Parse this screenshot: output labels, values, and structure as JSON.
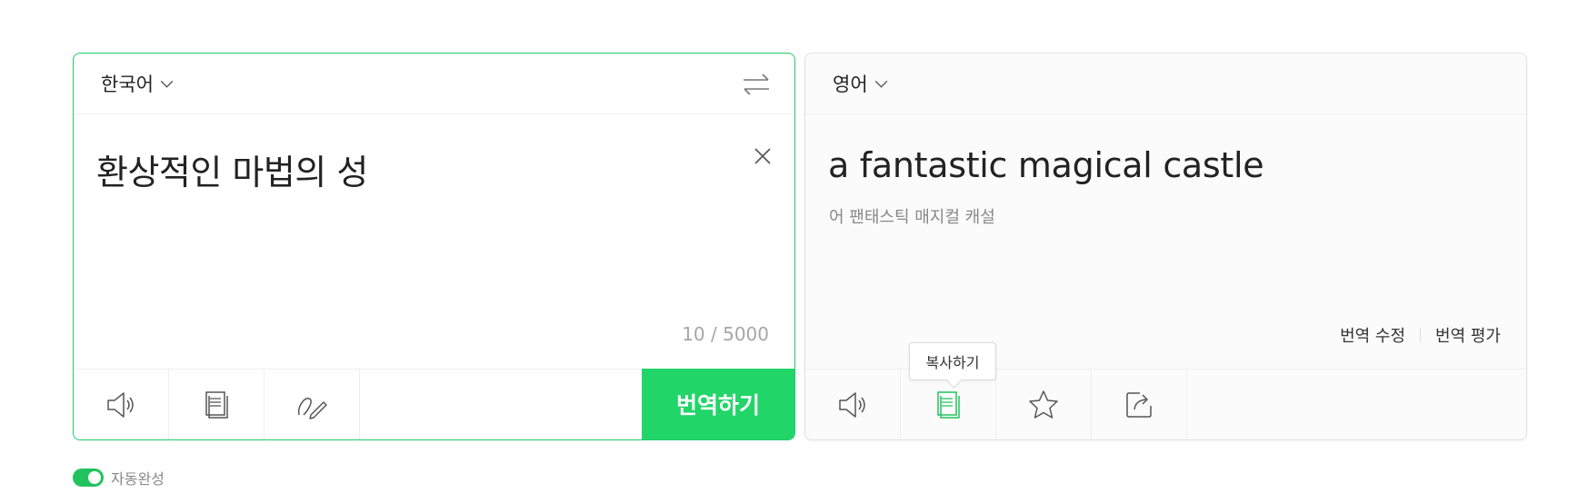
{
  "source": {
    "language": "한국어",
    "text": "환상적인 마법의 성",
    "char_count": "10 / 5000",
    "translate_button": "번역하기",
    "border_color": "#1ec96a"
  },
  "target": {
    "language": "영어",
    "text": "a fantastic magical castle",
    "pronunciation": "어 팬태스틱 매지컬 캐설",
    "edit_link": "번역 수정",
    "rate_link": "번역 평가",
    "copy_tooltip": "복사하기"
  },
  "autocomplete": {
    "label": "자동완성",
    "enabled": true
  },
  "colors": {
    "accent": "#22d569",
    "icon": "#555555",
    "active_icon": "#22c35e"
  },
  "icons": {
    "source_toolbar": [
      "speaker-icon",
      "copy-icon",
      "handwriting-icon"
    ],
    "target_toolbar": [
      "speaker-icon",
      "copy-icon",
      "star-icon",
      "share-icon"
    ],
    "header": [
      "swap-icon",
      "chevron-down-icon",
      "close-icon"
    ]
  }
}
